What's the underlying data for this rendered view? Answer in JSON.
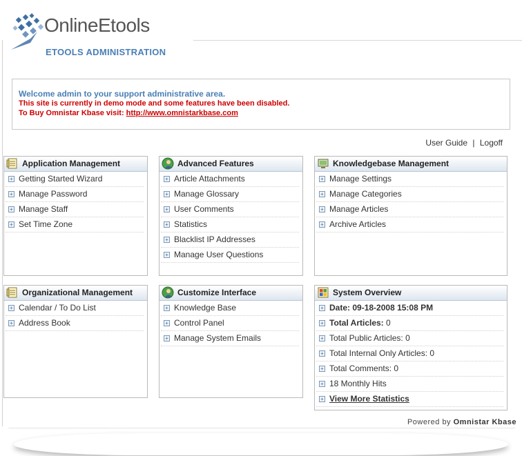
{
  "logo": {
    "name": "OnlineEtools",
    "subtitle": "ETOOLS ADMINISTRATION"
  },
  "welcome": {
    "line1": "Welcome admin to your support administrative area.",
    "line2": "This site is currently in demo mode and some features have been disabled.",
    "line3_prefix": "To Buy Omnistar Kbase visit:",
    "line3_link": "http://www.omnistarkbase.com"
  },
  "userlinks": {
    "guide": "User Guide",
    "sep": "|",
    "logoff": "Logoff"
  },
  "panels": {
    "app": {
      "title": "Application Management",
      "items": [
        "Getting Started Wizard",
        "Manage Password",
        "Manage Staff",
        "Set Time Zone"
      ]
    },
    "adv": {
      "title": "Advanced Features",
      "items": [
        "Article Attachments",
        "Manage Glossary",
        "User Comments",
        "Statistics",
        "Blacklist IP Addresses",
        "Manage User Questions"
      ]
    },
    "kb": {
      "title": "Knowledgebase Management",
      "items": [
        "Manage Settings",
        "Manage Categories",
        "Manage Articles",
        "Archive Articles"
      ]
    },
    "org": {
      "title": "Organizational Management",
      "items": [
        "Calendar / To Do List",
        "Address Book"
      ]
    },
    "cust": {
      "title": "Customize Interface",
      "items": [
        "Knowledge Base",
        "Control Panel",
        "Manage System Emails"
      ]
    },
    "sys": {
      "title": "System Overview",
      "date_label": "Date:",
      "date_value": "09-18-2008 15:08 PM",
      "total_articles_label": "Total Articles:",
      "total_articles": "0",
      "public_label": "Total Public Articles:",
      "public": "0",
      "internal_label": "Total Internal Only Articles:",
      "internal": "0",
      "comments_label": "Total Comments:",
      "comments": "0",
      "monthly_hits": "18 Monthly Hits",
      "more_link": "View More Statistics"
    }
  },
  "footer": {
    "powered_prefix": "Powered by",
    "powered_name": "Omnistar Kbase"
  },
  "colors": {
    "brand_blue": "#4a7fb5",
    "alert_red": "#cc0000"
  }
}
